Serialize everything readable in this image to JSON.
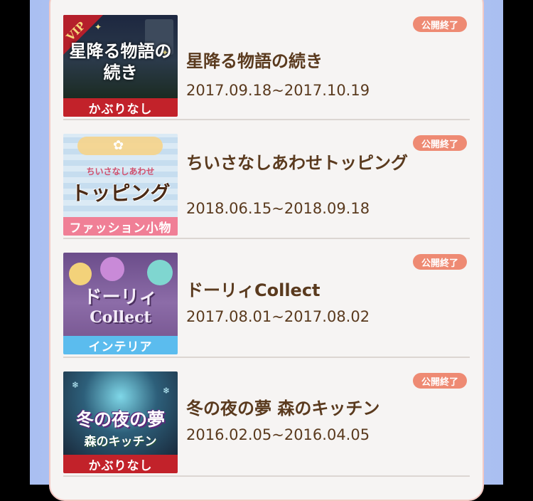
{
  "events": [
    {
      "title": "星降る物語の続き",
      "dates": "2017.09.18~2017.10.19",
      "status": "公開終了",
      "thumb_title": "星降る物語の続き",
      "thumb_tag": "VIP",
      "caption": "かぶりなし",
      "caption_color": "#c2222a"
    },
    {
      "title": "ちいさなしあわせトッピング",
      "dates": "2018.06.15~2018.09.18",
      "status": "公開終了",
      "thumb_subtitle": "ちいさなしあわせ",
      "thumb_title": "トッピング",
      "caption": "ファッション小物",
      "caption_color": "#f07f96"
    },
    {
      "title": "ドーリィCollect",
      "dates": "2017.08.01~2017.08.02",
      "status": "公開終了",
      "thumb_title": "ドーリィ",
      "thumb_title2": "Collect",
      "caption": "インテリア",
      "caption_color": "#5bbcee"
    },
    {
      "title": "冬の夜の夢 森のキッチン",
      "dates": "2016.02.05~2016.04.05",
      "status": "公開終了",
      "thumb_title": "冬の夜の夢",
      "thumb_subtitle": "森のキッチン",
      "caption": "かぶりなし",
      "caption_color": "#c2222a"
    }
  ]
}
